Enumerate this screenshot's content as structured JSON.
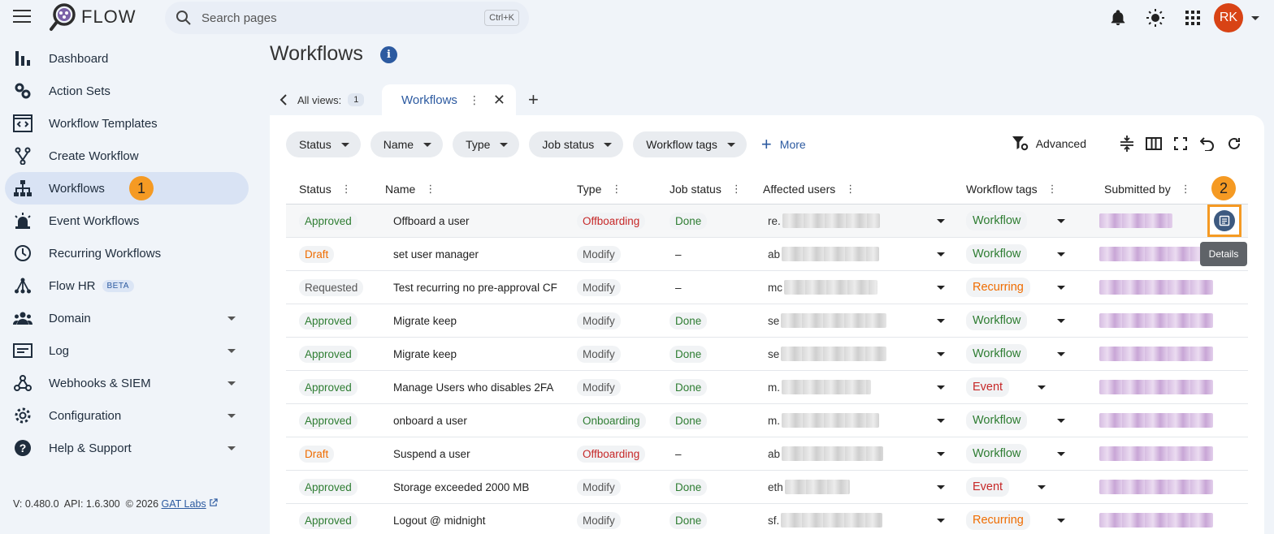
{
  "app": {
    "name": "FLOW"
  },
  "search": {
    "placeholder": "Search pages",
    "shortcut": "Ctrl+K"
  },
  "user": {
    "initials": "RK"
  },
  "sidebar": {
    "items": [
      {
        "label": "Dashboard",
        "icon": "bar-chart-icon",
        "active": false,
        "expandable": false
      },
      {
        "label": "Action Sets",
        "icon": "gears-icon",
        "active": false,
        "expandable": false
      },
      {
        "label": "Workflow Templates",
        "icon": "template-icon",
        "active": false,
        "expandable": false
      },
      {
        "label": "Create Workflow",
        "icon": "fork-icon",
        "active": false,
        "expandable": false
      },
      {
        "label": "Workflows",
        "icon": "sitemap-icon",
        "active": true,
        "expandable": false
      },
      {
        "label": "Event Workflows",
        "icon": "alarm-light-icon",
        "active": false,
        "expandable": false
      },
      {
        "label": "Recurring Workflows",
        "icon": "clock-icon",
        "active": false,
        "expandable": false
      },
      {
        "label": "Flow HR",
        "icon": "hierarchy-icon",
        "active": false,
        "expandable": false,
        "badge": "BETA"
      },
      {
        "label": "Domain",
        "icon": "people-icon",
        "active": false,
        "expandable": true
      },
      {
        "label": "Log",
        "icon": "log-icon",
        "active": false,
        "expandable": true
      },
      {
        "label": "Webhooks & SIEM",
        "icon": "webhook-icon",
        "active": false,
        "expandable": true
      },
      {
        "label": "Configuration",
        "icon": "gear-icon",
        "active": false,
        "expandable": true
      },
      {
        "label": "Help & Support",
        "icon": "help-icon",
        "active": false,
        "expandable": true
      }
    ],
    "step_badge": "1"
  },
  "footer": {
    "version": "V: 0.480.0",
    "api": "API: 1.6.300",
    "copyright": "© 2026",
    "company": "GAT Labs"
  },
  "main": {
    "title": "Workflows",
    "info": "i",
    "views": {
      "label": "All views:",
      "count": "1",
      "current": "Workflows"
    },
    "filters": [
      "Status",
      "Name",
      "Type",
      "Job status",
      "Workflow tags"
    ],
    "more_label": "More",
    "advanced_label": "Advanced",
    "columns": [
      "Status",
      "Name",
      "Type",
      "Job status",
      "Affected users",
      "Workflow tags",
      "Submitted by"
    ],
    "step_badge": "2",
    "details_tooltip": "Details",
    "rows": [
      {
        "status": "Approved",
        "name": "Offboard a user",
        "type": "Offboarding",
        "job": "Done",
        "user": "re.",
        "tag": "Workflow"
      },
      {
        "status": "Draft",
        "name": "set user manager",
        "type": "Modify",
        "job": "–",
        "user": "ab",
        "tag": "Workflow"
      },
      {
        "status": "Requested",
        "name": "Test recurring no pre-approval CF",
        "type": "Modify",
        "job": "–",
        "user": "mc",
        "tag": "Recurring"
      },
      {
        "status": "Approved",
        "name": "Migrate keep",
        "type": "Modify",
        "job": "Done",
        "user": "se",
        "tag": "Workflow"
      },
      {
        "status": "Approved",
        "name": "Migrate keep",
        "type": "Modify",
        "job": "Done",
        "user": "se",
        "tag": "Workflow"
      },
      {
        "status": "Approved",
        "name": "Manage Users who disables 2FA",
        "type": "Modify",
        "job": "Done",
        "user": "m.",
        "tag": "Event"
      },
      {
        "status": "Approved",
        "name": "onboard a user",
        "type": "Onboarding",
        "job": "Done",
        "user": "m.",
        "tag": "Workflow"
      },
      {
        "status": "Draft",
        "name": "Suspend a user",
        "type": "Offboarding",
        "job": "–",
        "user": "ab",
        "tag": "Workflow"
      },
      {
        "status": "Approved",
        "name": "Storage exceeded 2000 MB",
        "type": "Modify",
        "job": "Done",
        "user": "eth",
        "tag": "Event"
      },
      {
        "status": "Approved",
        "name": "Logout @ midnight",
        "type": "Modify",
        "job": "Done",
        "user": "sf.",
        "tag": "Recurring"
      }
    ]
  },
  "colors": {
    "accent": "#2c5aa0",
    "approved": "#2e7d32",
    "draft": "#ef6c00",
    "offboarding": "#c62828",
    "highlight": "#f59a23",
    "avatar": "#d84315"
  }
}
